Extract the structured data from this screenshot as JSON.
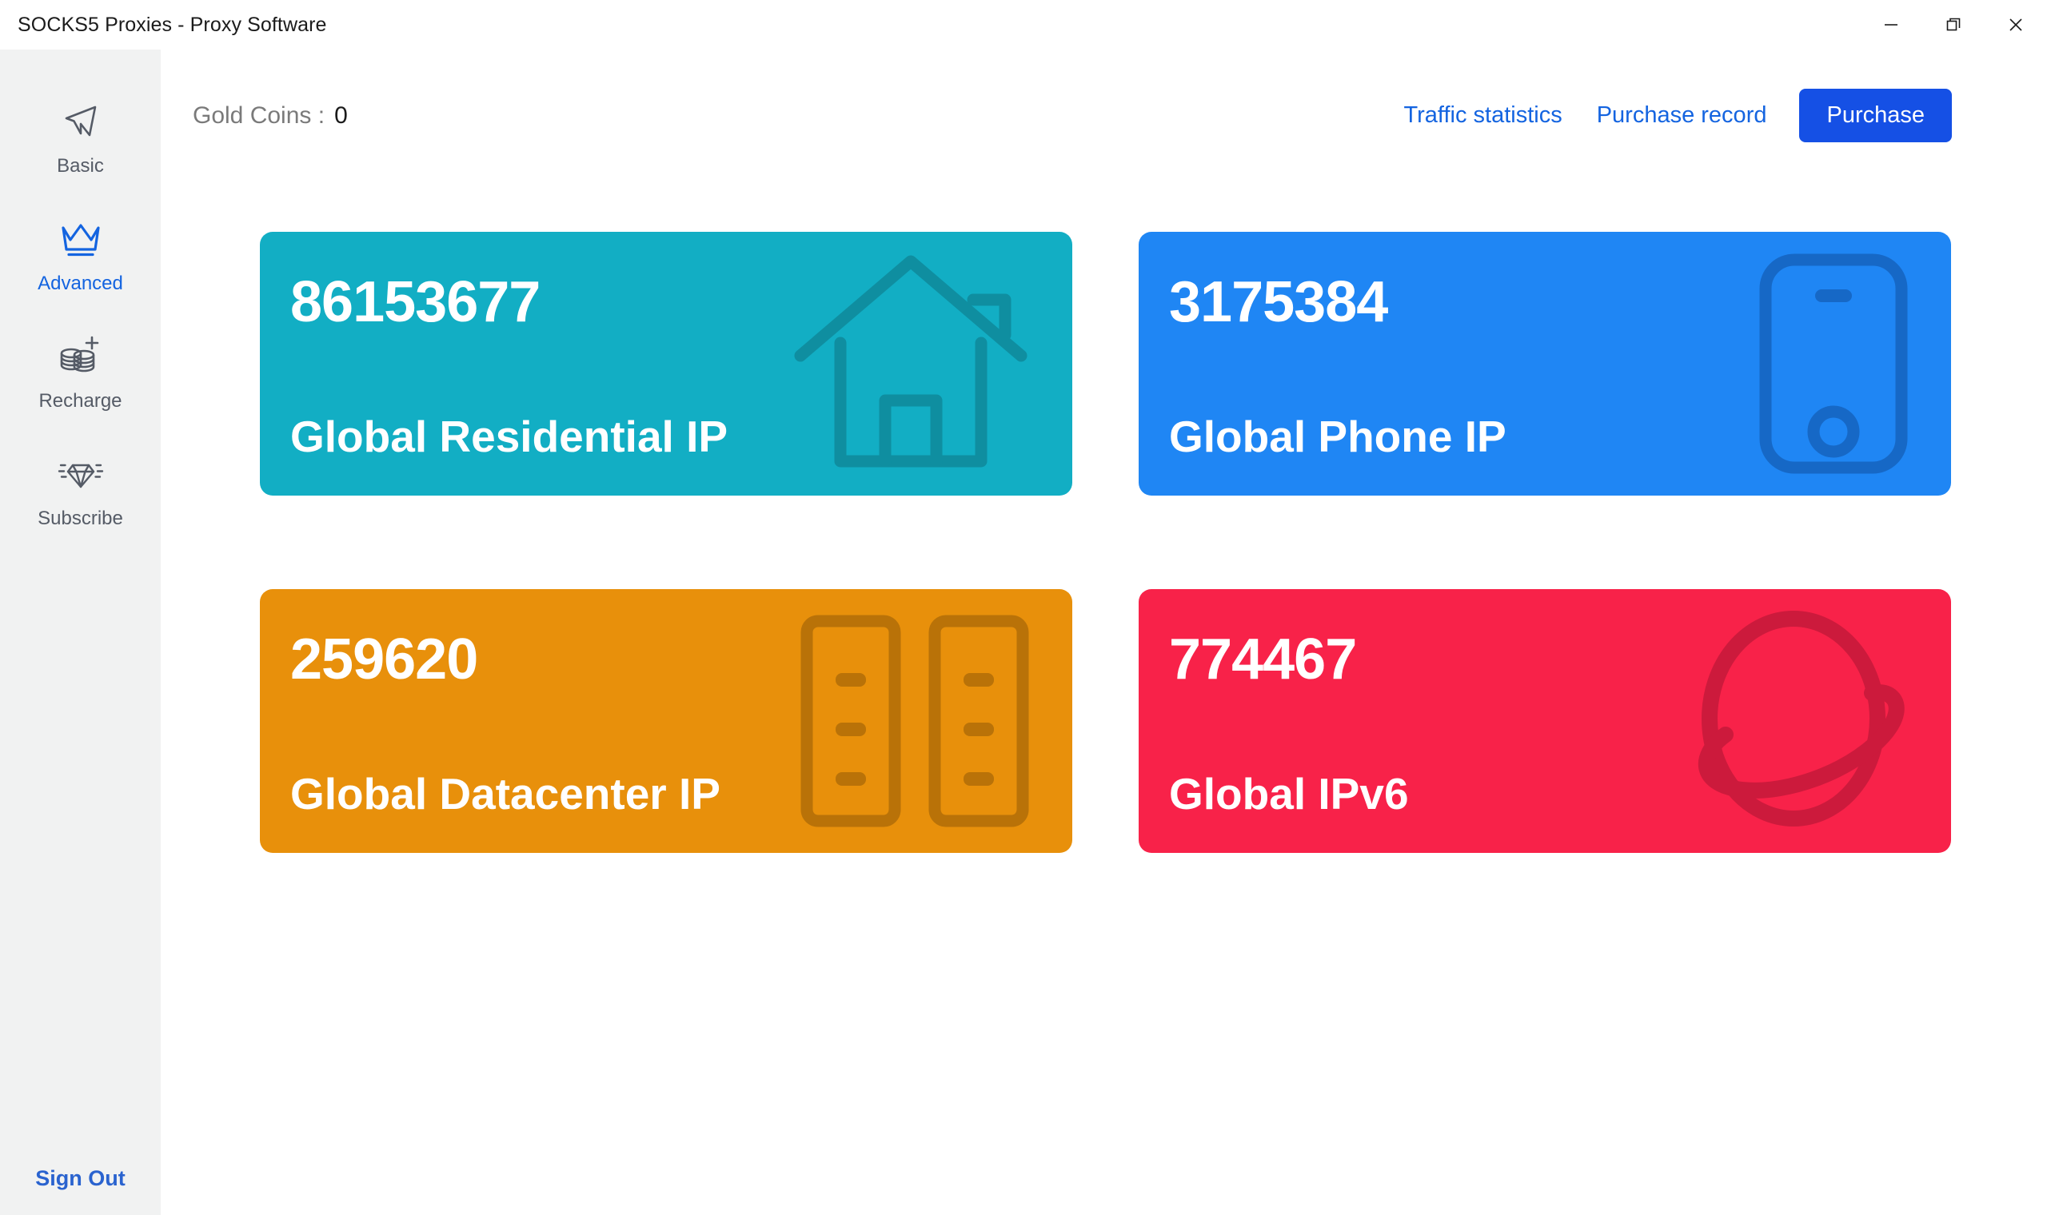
{
  "window": {
    "title": "SOCKS5 Proxies - Proxy Software",
    "controls": {
      "minimize": "minimize-button",
      "restore": "restore-button",
      "close": "close-button"
    }
  },
  "sidebar": {
    "items": [
      {
        "label": "Basic",
        "icon": "paper-plane-icon",
        "active": false
      },
      {
        "label": "Advanced",
        "icon": "crown-icon",
        "active": true
      },
      {
        "label": "Recharge",
        "icon": "coins-plus-icon",
        "active": false
      },
      {
        "label": "Subscribe",
        "icon": "diamond-icon",
        "active": false
      }
    ],
    "sign_out_label": "Sign Out",
    "active_color": "#1464e0",
    "inactive_color": "#555b66",
    "background": "#f1f2f2",
    "sign_out_color": "#2a63cf"
  },
  "topbar": {
    "gold_coins_label": "Gold Coins :",
    "gold_coins_value": "0",
    "traffic_statistics_label": "Traffic statistics",
    "purchase_record_label": "Purchase record",
    "purchase_button_label": "Purchase",
    "link_color": "#1464e0",
    "button_color": "#1550e5"
  },
  "cards": [
    {
      "count": "86153677",
      "title": "Global Residential IP",
      "color": "#12aec4",
      "art_color": "#0f8ea0",
      "icon": "house-icon"
    },
    {
      "count": "3175384",
      "title": "Global Phone IP",
      "color": "#1f86f4",
      "art_color": "#1668c6",
      "icon": "smartphone-icon"
    },
    {
      "count": "259620",
      "title": "Global Datacenter IP",
      "color": "#e8900b",
      "art_color": "#b97208",
      "icon": "server-rack-icon"
    },
    {
      "count": "774467",
      "title": "Global IPv6",
      "color": "#f82249",
      "art_color": "#cc1a3c",
      "icon": "planet-orbit-icon"
    }
  ]
}
